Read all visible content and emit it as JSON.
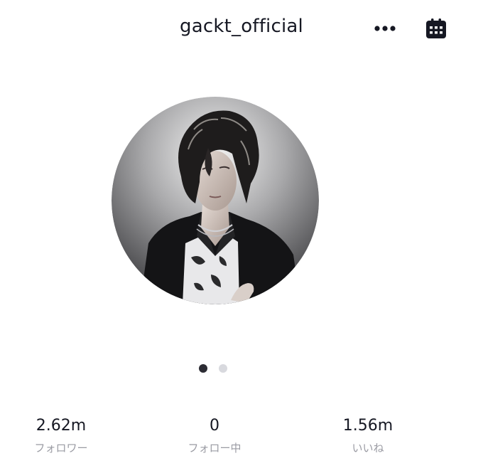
{
  "header": {
    "username": "gackt_official",
    "more_icon": "more-horizontal-icon",
    "calendar_icon": "calendar-icon"
  },
  "avatar": {
    "icon": "profile-photo"
  },
  "carousel": {
    "page_count": 2,
    "active_index": 0
  },
  "stats": [
    {
      "value": "2.62m",
      "label": "フォロワー"
    },
    {
      "value": "0",
      "label": "フォロー中"
    },
    {
      "value": "1.56m",
      "label": "いいね"
    }
  ],
  "colors": {
    "text_primary": "#161823",
    "text_secondary": "#9a9ba3",
    "dot_active": "#2c2c34",
    "dot_inactive": "#d8d9de"
  }
}
